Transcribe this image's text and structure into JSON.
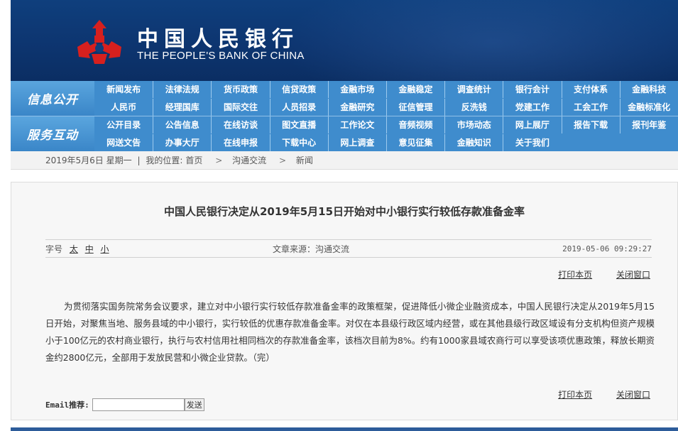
{
  "header": {
    "logo_cn": "中国人民银行",
    "logo_en": "THE PEOPLE'S BANK OF CHINA",
    "colors": {
      "banner": "#0f3f7d",
      "emblem": "#d7201e",
      "nav": "#3f8ccd"
    }
  },
  "nav": {
    "block1_title": "信息公开",
    "block1_row1": [
      "新闻发布",
      "法律法规",
      "货币政策",
      "信贷政策",
      "金融市场",
      "金融稳定",
      "调查统计",
      "银行会计",
      "支付体系",
      "金融科技"
    ],
    "block1_row2": [
      "人民币",
      "经理国库",
      "国际交往",
      "人员招录",
      "金融研究",
      "征信管理",
      "反洗钱",
      "党建工作",
      "工会工作",
      "金融标准化"
    ],
    "block2_title": "服务互动",
    "block2_row1": [
      "公开目录",
      "公告信息",
      "在线访谈",
      "图文直播",
      "工作论文",
      "音频视频",
      "市场动态",
      "网上展厅",
      "报告下载",
      "报刊年鉴"
    ],
    "block2_row2": [
      "网送文告",
      "办事大厅",
      "在线申报",
      "下载中心",
      "网上调查",
      "意见征集",
      "金融知识",
      "关于我们"
    ]
  },
  "breadcrumb": {
    "date": "2019年5月6日 星期一",
    "location_label": "我的位置:",
    "items": [
      "首页",
      "沟通交流",
      "新闻"
    ]
  },
  "article": {
    "title": "中国人民银行决定从2019年5月15日开始对中小银行实行较低存款准备金率",
    "font_size_label": "字号",
    "font_sizes": [
      "太",
      "中",
      "小"
    ],
    "source": "文章来源：沟通交流",
    "datetime": "2019-05-06 09:29:27",
    "print_label": "打印本页",
    "close_label": "关闭窗口",
    "body": "为贯彻落实国务院常务会议要求，建立对中小银行实行较低存款准备金率的政策框架，促进降低小微企业融资成本，中国人民银行决定从2019年5月15日开始，对聚焦当地、服务县域的中小银行，实行较低的优惠存款准备金率。对仅在本县级行政区域内经营，或在其他县级行政区域设有分支机构但资产规模小于100亿元的农村商业银行，执行与农村信用社相同档次的存款准备金率，该档次目前为8%。约有1000家县域农商行可以享受该项优惠政策，释放长期资金约2800亿元，全部用于发放民营和小微企业贷款。（完）",
    "email_label": "Email推荐:",
    "email_value": "",
    "send_label": "发送"
  }
}
